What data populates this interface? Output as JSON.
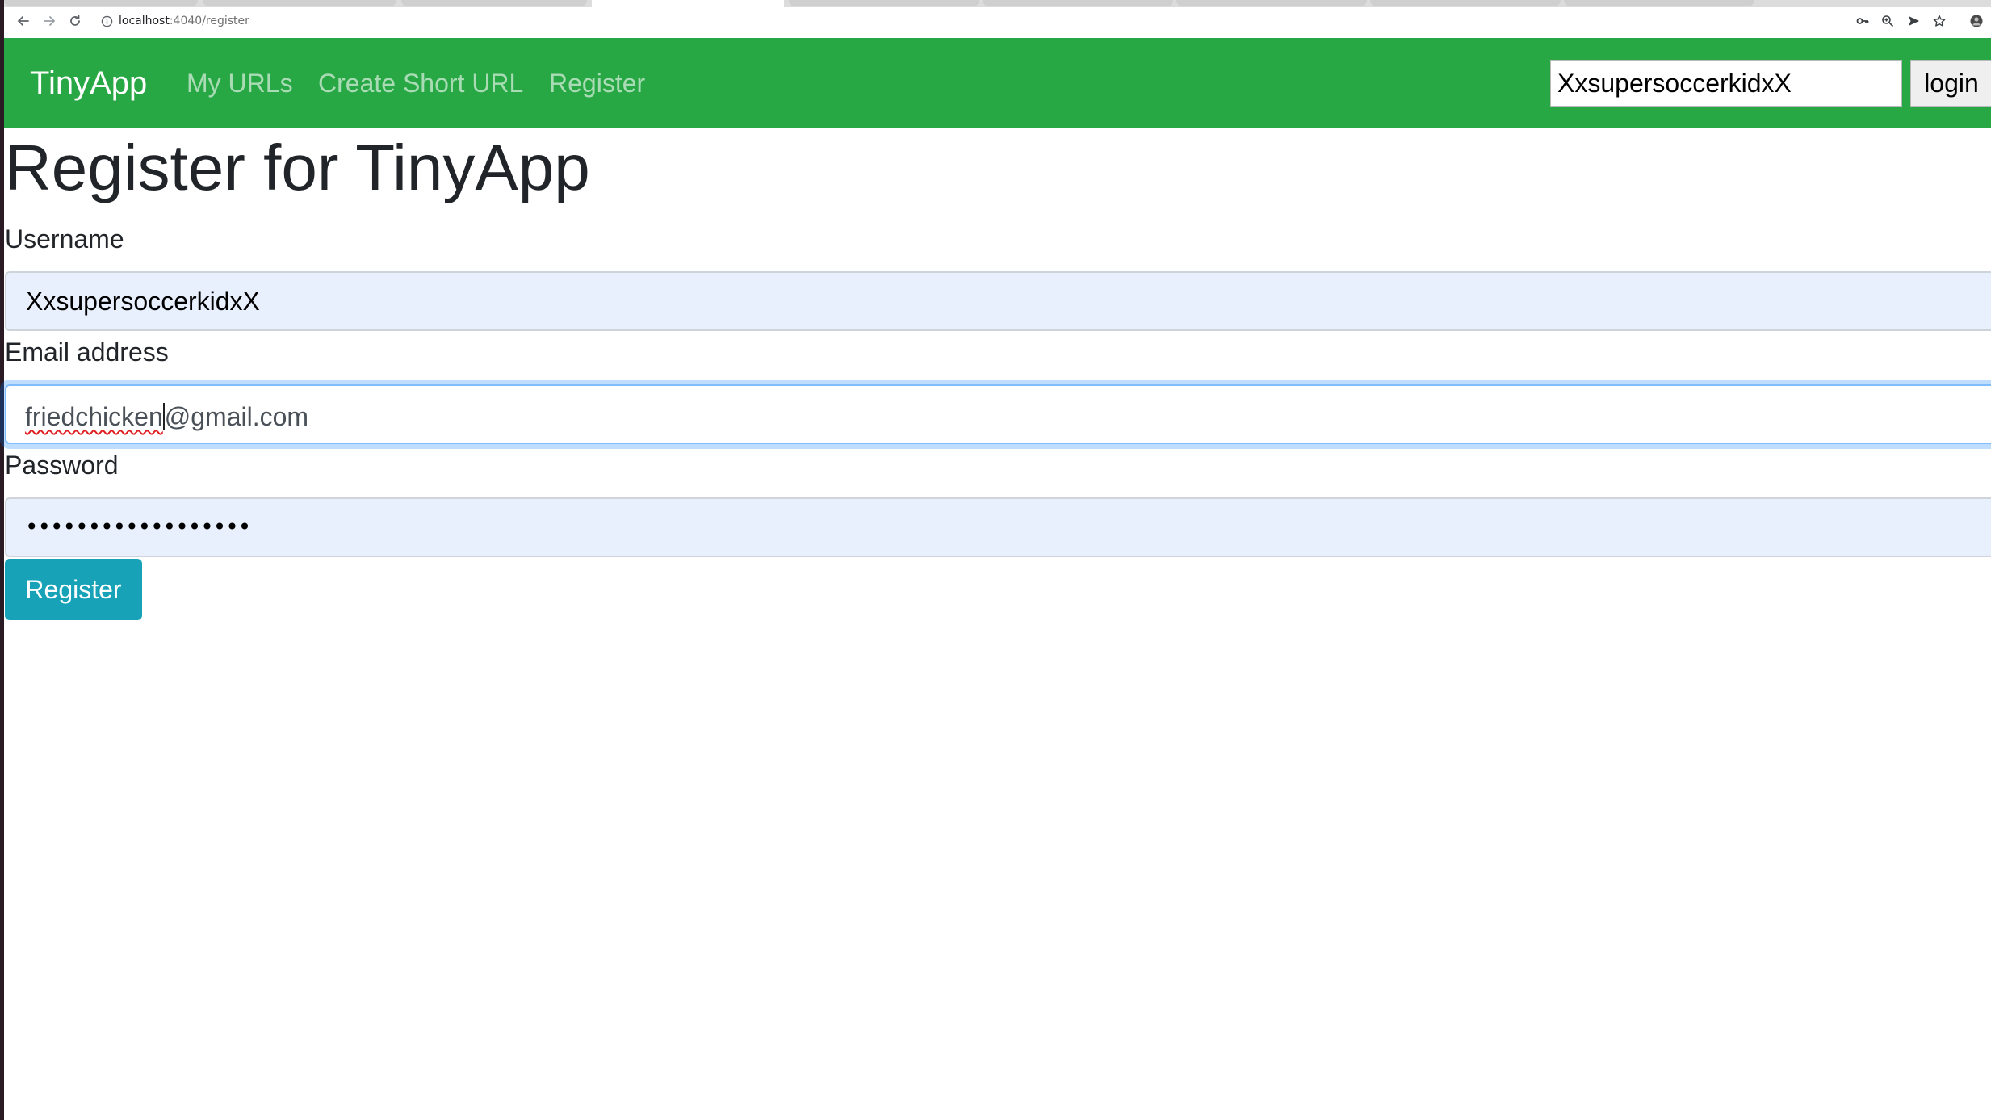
{
  "browser": {
    "url_host": "localhost",
    "url_path": ":4040/register"
  },
  "navbar": {
    "brand": "TinyApp",
    "links": [
      "My URLs",
      "Create Short URL",
      "Register"
    ],
    "username_value": "XxsupersoccerkidxX",
    "login_label": "login",
    "color": "#28a745"
  },
  "form": {
    "title": "Register for TinyApp",
    "username_label": "Username",
    "username_value": "XxsupersoccerkidxX",
    "email_label": "Email address",
    "email_value_misspelled": "friedchicken",
    "email_value_rest": "@gmail.com",
    "password_label": "Password",
    "password_mask": "••••••••••••••••••",
    "submit_label": "Register",
    "submit_color": "#17a2b8"
  }
}
